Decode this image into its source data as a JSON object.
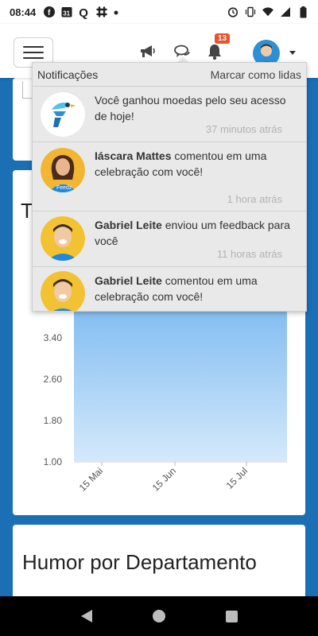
{
  "status_bar": {
    "time": "08:44",
    "left_icons": [
      "facebook-icon",
      "calendar-icon",
      "q-icon",
      "slack-icon",
      "dot-icon"
    ],
    "calendar_day": "31",
    "q_letter": "Q",
    "right_icons": [
      "alarm-icon",
      "vibrate-icon",
      "wifi-icon",
      "signal-icon",
      "battery-icon"
    ]
  },
  "app_bar": {
    "notification_count": "13",
    "icons": [
      "megaphone-icon",
      "chat-icon",
      "bell-icon"
    ]
  },
  "notifications": {
    "title": "Notificações",
    "mark_read": "Marcar como lidas",
    "items": [
      {
        "name": "",
        "text": "Você ganhou moedas pelo seu acesso de hoje!",
        "time": "37 minutos atrás",
        "avatar": "feedz-logo"
      },
      {
        "name": "Iáscara Mattes",
        "text": "comentou em uma celebração com você!",
        "time": "1 hora atrás",
        "avatar": "woman-avatar"
      },
      {
        "name": "Gabriel Leite",
        "text": "enviou um feedback para você",
        "time": "11 horas atrás",
        "avatar": "man-avatar"
      },
      {
        "name": "Gabriel Leite",
        "text": "comentou em uma celebração com você!",
        "time": "",
        "avatar": "man-avatar"
      }
    ]
  },
  "chart_card": {
    "title_partial": "T",
    "avatar_badge_text": "Feedz"
  },
  "chart_data": {
    "type": "area",
    "x_tick_labels": [
      "15 Mai",
      "15 Jun",
      "15 Jul"
    ],
    "y_tick_labels": [
      "1.00",
      "1.80",
      "2.60",
      "3.40"
    ],
    "ylim": [
      1.0,
      4.2
    ],
    "series": [
      {
        "values_visible_top": [
          4.2,
          4.05,
          4.15,
          4.0,
          4.1,
          3.95,
          4.15,
          4.05,
          4.2
        ]
      }
    ],
    "fill_color": "#8cc3f2",
    "line_color": "#4a9de8"
  },
  "dept_card": {
    "title": "Humor por Departamento"
  },
  "colors": {
    "background": "#1a6fb5",
    "badge": "#e8542e",
    "panel": "#e9e9e9"
  }
}
